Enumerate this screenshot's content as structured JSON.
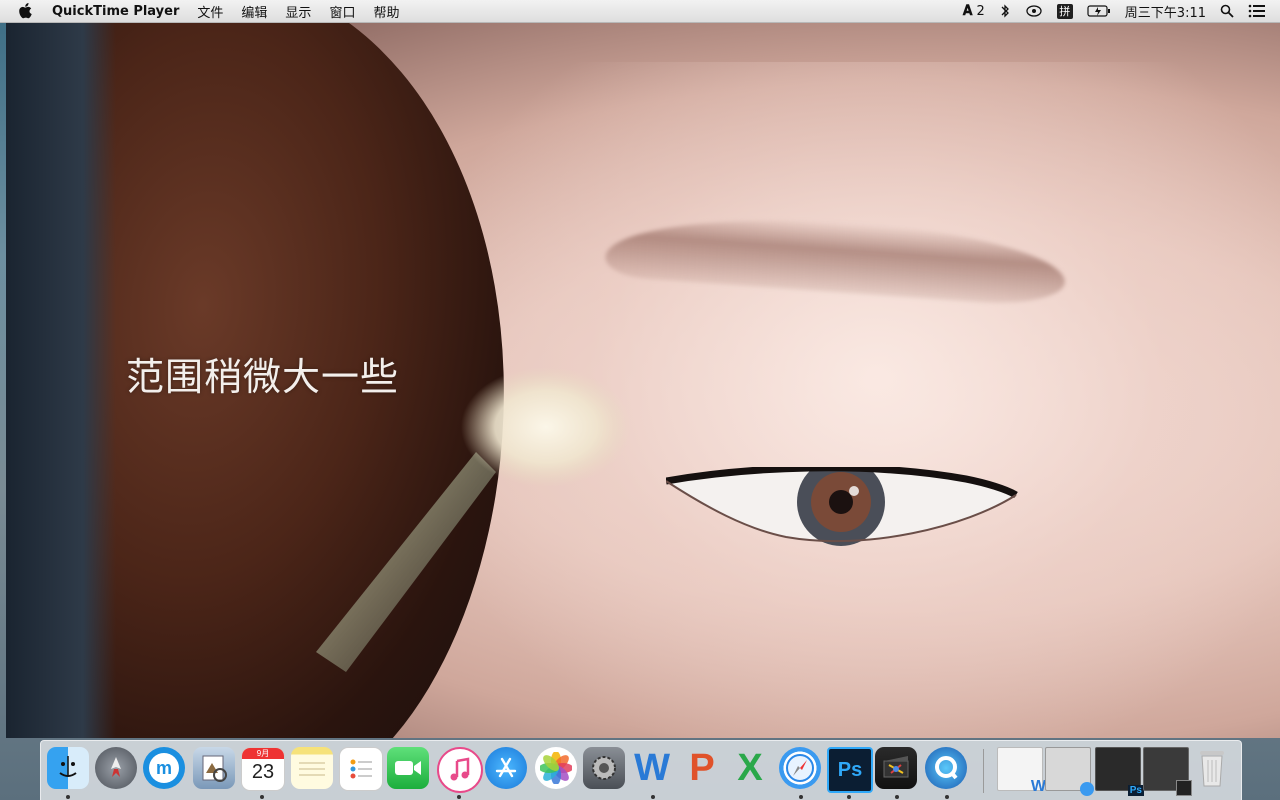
{
  "menubar": {
    "app_name": "QuickTime Player",
    "menus": [
      "文件",
      "编辑",
      "显示",
      "窗口",
      "帮助"
    ],
    "adobe_badge": "2",
    "input_method": "拼",
    "clock": "周三下午3:11"
  },
  "video": {
    "subtitle": "范围稍微大一些"
  },
  "dock": {
    "calendar_month": "9月",
    "calendar_day": "23",
    "apps": [
      "Finder",
      "Launchpad",
      "Maxthon",
      "Preview",
      "Calendar",
      "Notes",
      "Reminders",
      "FaceTime",
      "iTunes",
      "App Store",
      "Photos",
      "System Preferences",
      "Word",
      "PowerPoint",
      "Excel",
      "Safari",
      "Photoshop",
      "Final Cut Pro",
      "QuickTime Player"
    ]
  },
  "colors": {
    "menubar_bg": "#e8e8e8",
    "dock_bg": "#e1e4e8",
    "subtitle": "#f3efec"
  }
}
